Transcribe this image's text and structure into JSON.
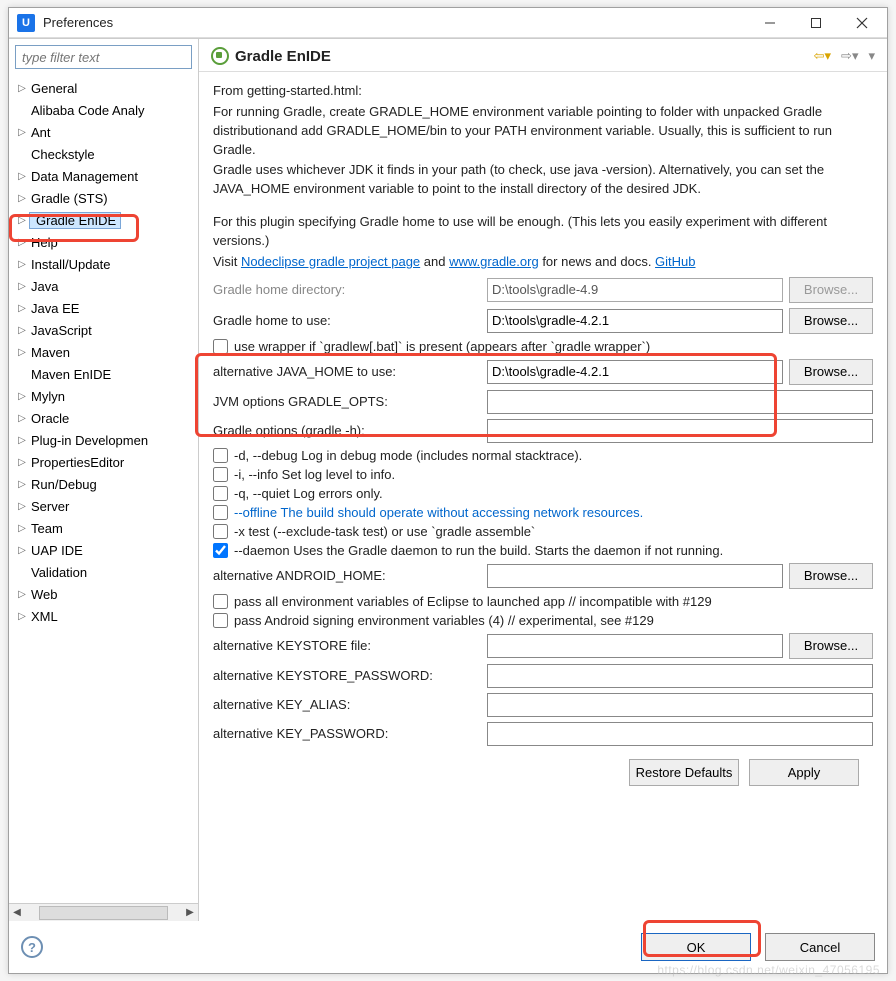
{
  "window": {
    "title": "Preferences"
  },
  "filter_placeholder": "type filter text",
  "tree": {
    "items": [
      {
        "label": "General",
        "expandable": true
      },
      {
        "label": "Alibaba Code Analy",
        "expandable": false
      },
      {
        "label": "Ant",
        "expandable": true
      },
      {
        "label": "Checkstyle",
        "expandable": false
      },
      {
        "label": "Data Management",
        "expandable": true
      },
      {
        "label": "Gradle (STS)",
        "expandable": true
      },
      {
        "label": "Gradle EnIDE",
        "expandable": true,
        "selected": true
      },
      {
        "label": "Help",
        "expandable": true
      },
      {
        "label": "Install/Update",
        "expandable": true
      },
      {
        "label": "Java",
        "expandable": true
      },
      {
        "label": "Java EE",
        "expandable": true
      },
      {
        "label": "JavaScript",
        "expandable": true
      },
      {
        "label": "Maven",
        "expandable": true
      },
      {
        "label": "Maven EnIDE",
        "expandable": false
      },
      {
        "label": "Mylyn",
        "expandable": true
      },
      {
        "label": "Oracle",
        "expandable": true
      },
      {
        "label": "Plug-in Developmen",
        "expandable": true
      },
      {
        "label": "PropertiesEditor",
        "expandable": true
      },
      {
        "label": "Run/Debug",
        "expandable": true
      },
      {
        "label": "Server",
        "expandable": true
      },
      {
        "label": "Team",
        "expandable": true
      },
      {
        "label": "UAP IDE",
        "expandable": true
      },
      {
        "label": "Validation",
        "expandable": false
      },
      {
        "label": "Web",
        "expandable": true
      },
      {
        "label": "XML",
        "expandable": true
      }
    ]
  },
  "page": {
    "title": "Gradle EnIDE",
    "intro_line": "From getting-started.html:",
    "para1": "For running Gradle, create GRADLE_HOME environment variable pointing to folder with unpacked Gradle distributionand add GRADLE_HOME/bin to your PATH environment variable. Usually, this is sufficient to run Gradle.",
    "para2": "Gradle uses whichever JDK it finds in your path (to check, use java -version). Alternatively, you can set the JAVA_HOME environment variable to point to the install directory of the desired JDK.",
    "para3": "For this plugin specifying Gradle home to use will be enough. (This lets you easily experiment with different versions.)",
    "visit_prefix": "Visit ",
    "link1": "Nodeclipse gradle project page",
    "visit_middle": "  and ",
    "link2": "www.gradle.org",
    "visit_suffix": " for news and docs.  ",
    "link3": "GitHub",
    "fields": {
      "gradle_home_dir_label": "Gradle home directory:",
      "gradle_home_dir_value": "D:\\tools\\gradle-4.9",
      "gradle_home_use_label": "Gradle home to use:",
      "gradle_home_use_value": "D:\\tools\\gradle-4.2.1",
      "use_wrapper_label": "use wrapper if `gradlew[.bat]` is present (appears after `gradle wrapper`)",
      "alt_java_home_label": "alternative JAVA_HOME to use:",
      "alt_java_home_value": "D:\\tools\\gradle-4.2.1",
      "jvm_opts_label": "JVM options GRADLE_OPTS:",
      "jvm_opts_value": "",
      "gradle_opts_label": "Gradle options (gradle -h):",
      "gradle_opts_value": "",
      "opt_debug": "-d, --debug Log in debug mode (includes normal stacktrace).",
      "opt_info": "-i, --info Set log level to info.",
      "opt_quiet": "-q, --quiet Log errors only.",
      "opt_offline": "--offline The build should operate without accessing network resources.",
      "opt_xtest": "-x test (--exclude-task test) or use `gradle assemble`",
      "opt_daemon": "--daemon Uses the Gradle daemon to run the build. Starts the daemon if not running.",
      "alt_android_label": "alternative ANDROID_HOME:",
      "alt_android_value": "",
      "pass_env_label": "pass all environment variables of Eclipse to launched app // incompatible with #129",
      "pass_sign_label": "pass Android signing environment variables (4) // experimental, see #129",
      "keystore_file_label": "alternative KEYSTORE file:",
      "keystore_file_value": "",
      "keystore_pw_label": "alternative KEYSTORE_PASSWORD:",
      "keystore_pw_value": "",
      "key_alias_label": "alternative KEY_ALIAS:",
      "key_alias_value": "",
      "key_pw_label": "alternative KEY_PASSWORD:",
      "key_pw_value": ""
    },
    "browse": "Browse...",
    "restore_defaults": "Restore Defaults",
    "apply": "Apply",
    "ok": "OK",
    "cancel": "Cancel"
  },
  "watermark": "https://blog.csdn.net/weixin_47056195"
}
